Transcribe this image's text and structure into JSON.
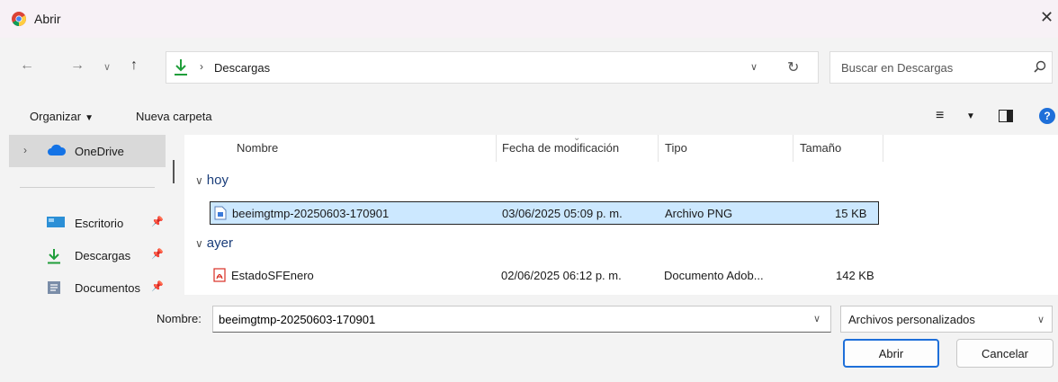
{
  "window": {
    "title": "Abrir"
  },
  "address": {
    "crumb": "Descargas"
  },
  "search": {
    "placeholder": "Buscar en Descargas"
  },
  "toolbar": {
    "organize_label": "Organizar",
    "new_folder_label": "Nueva carpeta"
  },
  "sidebar": {
    "onedrive_label": "OneDrive",
    "items": [
      {
        "label": "Escritorio"
      },
      {
        "label": "Descargas"
      },
      {
        "label": "Documentos"
      }
    ]
  },
  "columns": {
    "name": "Nombre",
    "modified": "Fecha de modificación",
    "type": "Tipo",
    "size": "Tamaño"
  },
  "groups": [
    {
      "label": "hoy",
      "files": [
        {
          "name": "beeimgtmp-20250603-170901",
          "modified": "03/06/2025 05:09 p. m.",
          "type": "Archivo PNG",
          "size": "15 KB",
          "icon": "image-file-icon"
        }
      ]
    },
    {
      "label": "ayer",
      "files": [
        {
          "name": "EstadoSFEnero",
          "modified": "02/06/2025 06:12 p. m.",
          "type": "Documento Adob...",
          "size": "142 KB",
          "icon": "pdf-file-icon"
        }
      ]
    }
  ],
  "footer": {
    "name_label": "Nombre:",
    "name_value": "beeimgtmp-20250603-170901",
    "filetype_value": "Archivos personalizados",
    "open_label": "Abrir",
    "cancel_label": "Cancelar"
  },
  "colors": {
    "accent": "#1e6fd9",
    "selection": "#cce8ff",
    "download_green": "#1f9e3a"
  }
}
